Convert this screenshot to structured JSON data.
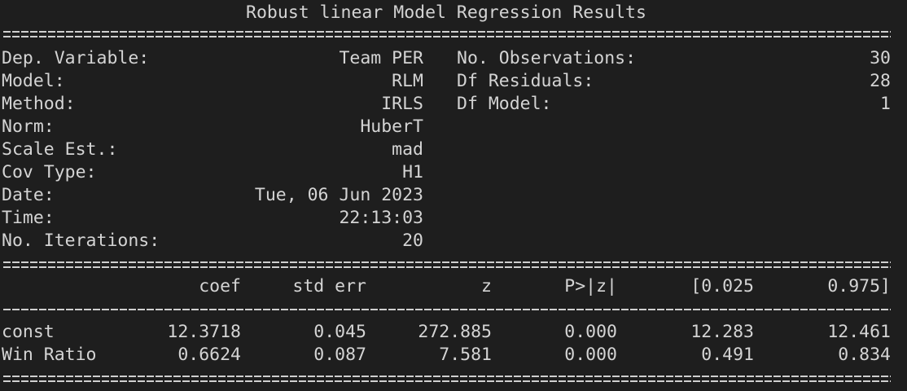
{
  "title": "Robust linear Model Regression Results",
  "header": {
    "left": [
      {
        "label": "Dep. Variable:",
        "value": "Team PER"
      },
      {
        "label": "Model:",
        "value": "RLM"
      },
      {
        "label": "Method:",
        "value": "IRLS"
      },
      {
        "label": "Norm:",
        "value": "HuberT"
      },
      {
        "label": "Scale Est.:",
        "value": "mad"
      },
      {
        "label": "Cov Type:",
        "value": "H1"
      },
      {
        "label": "Date:",
        "value": "Tue, 06 Jun 2023"
      },
      {
        "label": "Time:",
        "value": "22:13:03"
      },
      {
        "label": "No. Iterations:",
        "value": "20"
      }
    ],
    "right": [
      {
        "label": "No. Observations:",
        "value": "30"
      },
      {
        "label": "Df Residuals:",
        "value": "28"
      },
      {
        "label": "Df Model:",
        "value": "1"
      }
    ]
  },
  "coef_table": {
    "columns": [
      "coef",
      "std err",
      "z",
      "P>|z|",
      "[0.025",
      "0.975]"
    ],
    "rows": [
      {
        "name": "const",
        "cells": [
          "12.3718",
          "0.045",
          "272.885",
          "0.000",
          "12.283",
          "12.461"
        ]
      },
      {
        "name": "Win Ratio",
        "cells": [
          "0.6624",
          "0.087",
          "7.581",
          "0.000",
          "0.491",
          "0.834"
        ]
      }
    ]
  }
}
